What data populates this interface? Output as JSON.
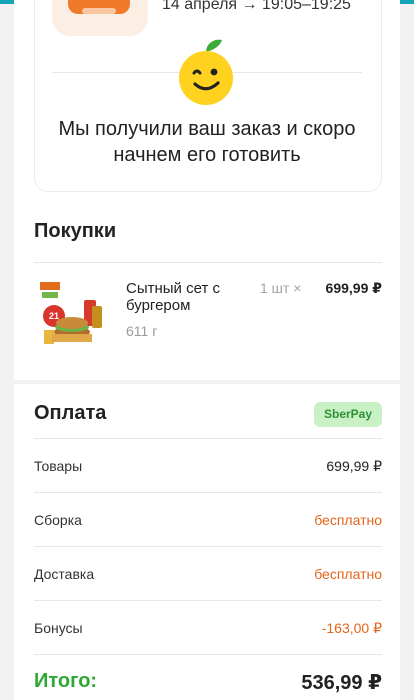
{
  "order": {
    "delivery_slot": "14 апреля → 19:05–19:25",
    "status_message": "Мы получили ваш заказ и скоро начнем его готовить"
  },
  "purchases": {
    "title": "Покупки",
    "items": [
      {
        "name": "Сытный сет с бургером",
        "weight": "611 г",
        "qty": "1 шт ×",
        "price": "699,99 ₽"
      }
    ]
  },
  "payment": {
    "title": "Оплата",
    "method_badge": "SberPay",
    "rows": [
      {
        "label": "Товары",
        "value": "699,99 ₽"
      },
      {
        "label": "Сборка",
        "value": "бесплатно"
      },
      {
        "label": "Доставка",
        "value": "бесплатно"
      },
      {
        "label": "Бонусы",
        "value": "-163,00 ₽"
      }
    ],
    "total_label": "Итого:",
    "total_value": "536,99 ₽"
  },
  "colors": {
    "accent_green": "#2da832",
    "accent_orange": "#e2661a",
    "badge_bg": "#c9f1c6",
    "mascot": "#ffd21f"
  },
  "icons": {
    "mascot": "winking-orange-mascot-icon"
  }
}
